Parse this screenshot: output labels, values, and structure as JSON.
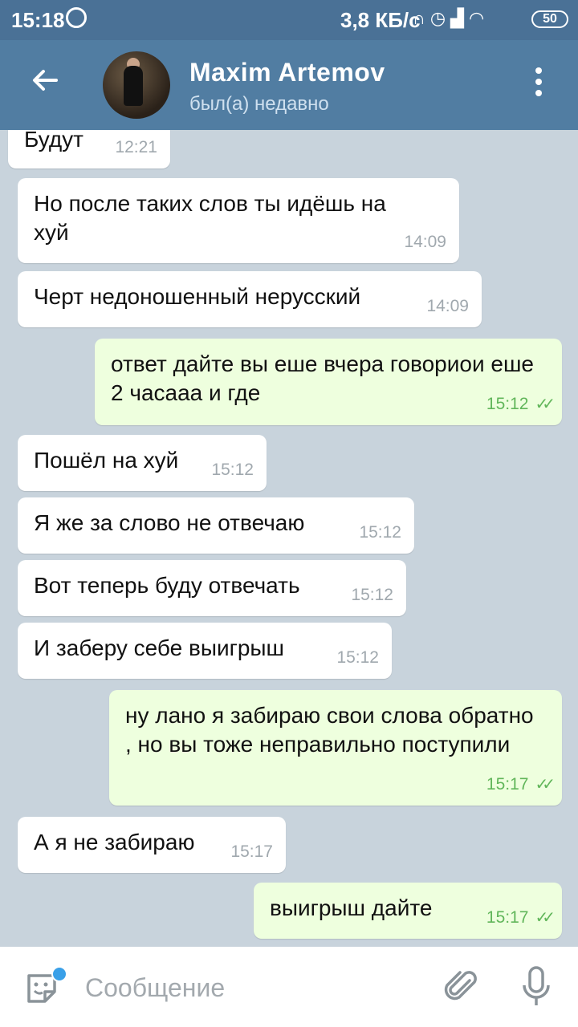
{
  "status_bar": {
    "time": "15:18",
    "speed": "3,8 КБ/с",
    "battery": "50"
  },
  "header": {
    "contact_name": "Maxim Artemov",
    "contact_status": "был(а) недавно"
  },
  "messages": [
    {
      "dir": "in",
      "text": "Будут",
      "time": "12:21"
    },
    {
      "dir": "in",
      "text": "Но после таких слов ты идёшь на хуй",
      "time": "14:09"
    },
    {
      "dir": "in",
      "text": "Черт недоношенный нерусский",
      "time": "14:09"
    },
    {
      "dir": "out",
      "text": "ответ дайте вы еше вчера говориои еше 2 часааа и где",
      "time": "15:12"
    },
    {
      "dir": "in",
      "text": "Пошёл на хуй",
      "time": "15:12"
    },
    {
      "dir": "in",
      "text": "Я же за слово не отвечаю",
      "time": "15:12"
    },
    {
      "dir": "in",
      "text": "Вот теперь буду отвечать",
      "time": "15:12"
    },
    {
      "dir": "in",
      "text": "И заберу себе выигрыш",
      "time": "15:12"
    },
    {
      "dir": "out",
      "text": "ну лано я забираю свои слова обратно , но вы тоже неправильно поступили",
      "time": "15:17"
    },
    {
      "dir": "in",
      "text": "А я не забираю",
      "time": "15:17"
    },
    {
      "dir": "out",
      "text": "выигрыш дайте",
      "time": "15:17"
    }
  ],
  "composer": {
    "placeholder": "Сообщение"
  },
  "colors": {
    "header": "#517da2",
    "status_bar": "#4a7196",
    "outgoing_bubble": "#eeffde",
    "incoming_bubble": "#ffffff",
    "read_ticks": "#61b65a"
  },
  "icons": [
    "whatsapp-icon",
    "headphones-icon",
    "alarm-icon",
    "signal-icon",
    "wifi-icon",
    "battery-icon",
    "back-arrow-icon",
    "more-vert-icon",
    "sticker-icon",
    "attach-icon",
    "mic-icon",
    "double-check-icon"
  ]
}
